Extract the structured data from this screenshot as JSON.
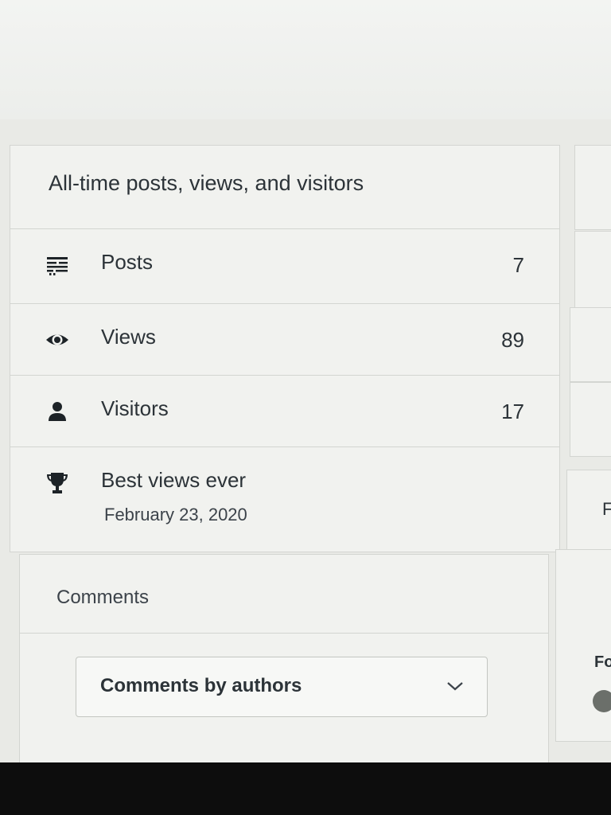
{
  "stats": {
    "title": "All-time posts, views, and visitors",
    "rows": [
      {
        "icon": "posts-icon",
        "label": "Posts",
        "value": "7"
      },
      {
        "icon": "eye-icon",
        "label": "Views",
        "value": "89"
      },
      {
        "icon": "person-icon",
        "label": "Visitors",
        "value": "17"
      }
    ],
    "best": {
      "icon": "trophy-icon",
      "label": "Best views ever",
      "date": "February 23, 2020"
    }
  },
  "comments": {
    "title": "Comments",
    "dropdown_label": "Comments by authors",
    "dropdown_icon": "chevron-down-icon"
  },
  "side": {
    "letter_f": "F",
    "letter_fo": "Fo"
  }
}
